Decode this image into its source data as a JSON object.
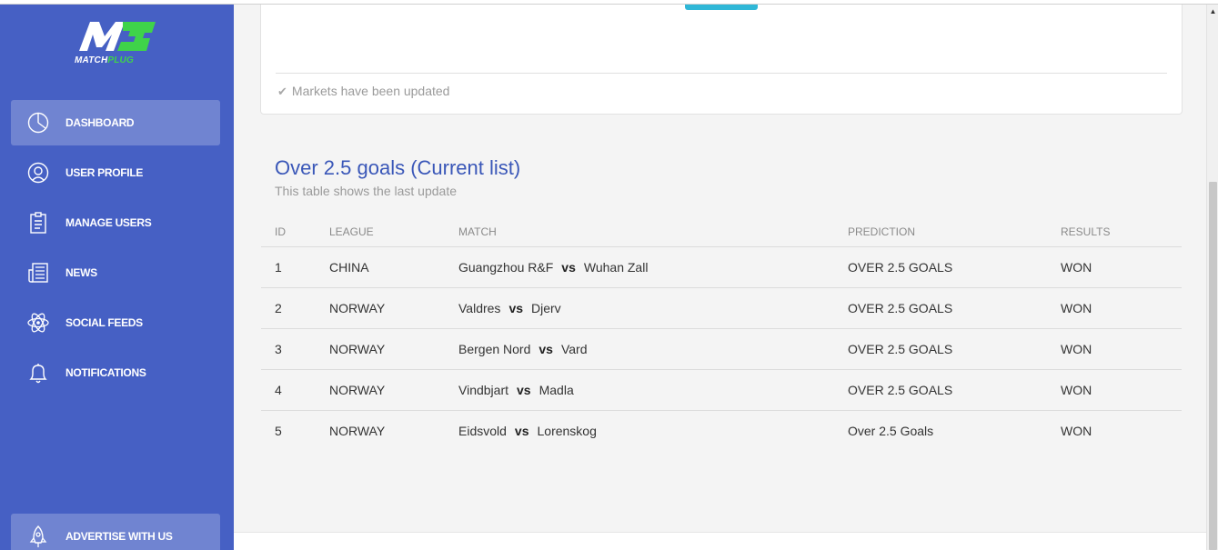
{
  "app": {
    "brand_name_1": "MATCH",
    "brand_name_2": "PLUG"
  },
  "sidebar": {
    "items": [
      {
        "label": "DASHBOARD",
        "icon": "pie-chart-icon",
        "active": true
      },
      {
        "label": "USER PROFILE",
        "icon": "user-icon",
        "active": false
      },
      {
        "label": "MANAGE USERS",
        "icon": "clipboard-icon",
        "active": false
      },
      {
        "label": "NEWS",
        "icon": "newspaper-icon",
        "active": false
      },
      {
        "label": "SOCIAL FEEDS",
        "icon": "atom-icon",
        "active": false
      },
      {
        "label": "NOTIFICATIONS",
        "icon": "bell-icon",
        "active": false
      }
    ],
    "advertise": {
      "label": "ADVERTISE WITH US",
      "icon": "rocket-icon"
    }
  },
  "card": {
    "footer": "Markets have been updated",
    "footer_icon": "check-icon"
  },
  "section": {
    "title": "Over 2.5 goals (Current list)",
    "subtitle": "This table shows the last update"
  },
  "table": {
    "headers": [
      "ID",
      "LEAGUE",
      "MATCH",
      "PREDICTION",
      "RESULTS"
    ],
    "vs_label": "vs",
    "rows": [
      {
        "id": "1",
        "league": "CHINA",
        "home": "Guangzhou R&F",
        "away": "Wuhan Zall",
        "prediction": "OVER 2.5 GOALS",
        "result": "WON"
      },
      {
        "id": "2",
        "league": "NORWAY",
        "home": "Valdres",
        "away": "Djerv",
        "prediction": "OVER 2.5 GOALS",
        "result": "WON"
      },
      {
        "id": "3",
        "league": "NORWAY",
        "home": "Bergen Nord",
        "away": "Vard",
        "prediction": "OVER 2.5 GOALS",
        "result": "WON"
      },
      {
        "id": "4",
        "league": "NORWAY",
        "home": "Vindbjart",
        "away": "Madla",
        "prediction": "OVER 2.5 GOALS",
        "result": "WON"
      },
      {
        "id": "5",
        "league": "NORWAY",
        "home": "Eidsvold",
        "away": "Lorenskog",
        "prediction": "Over 2.5 Goals",
        "result": "WON"
      }
    ]
  },
  "colors": {
    "sidebar_bg": "#4660c4",
    "title_blue": "#3a57b8",
    "logo_green": "#3fd34a",
    "card_accent": "#2fb7d7"
  }
}
